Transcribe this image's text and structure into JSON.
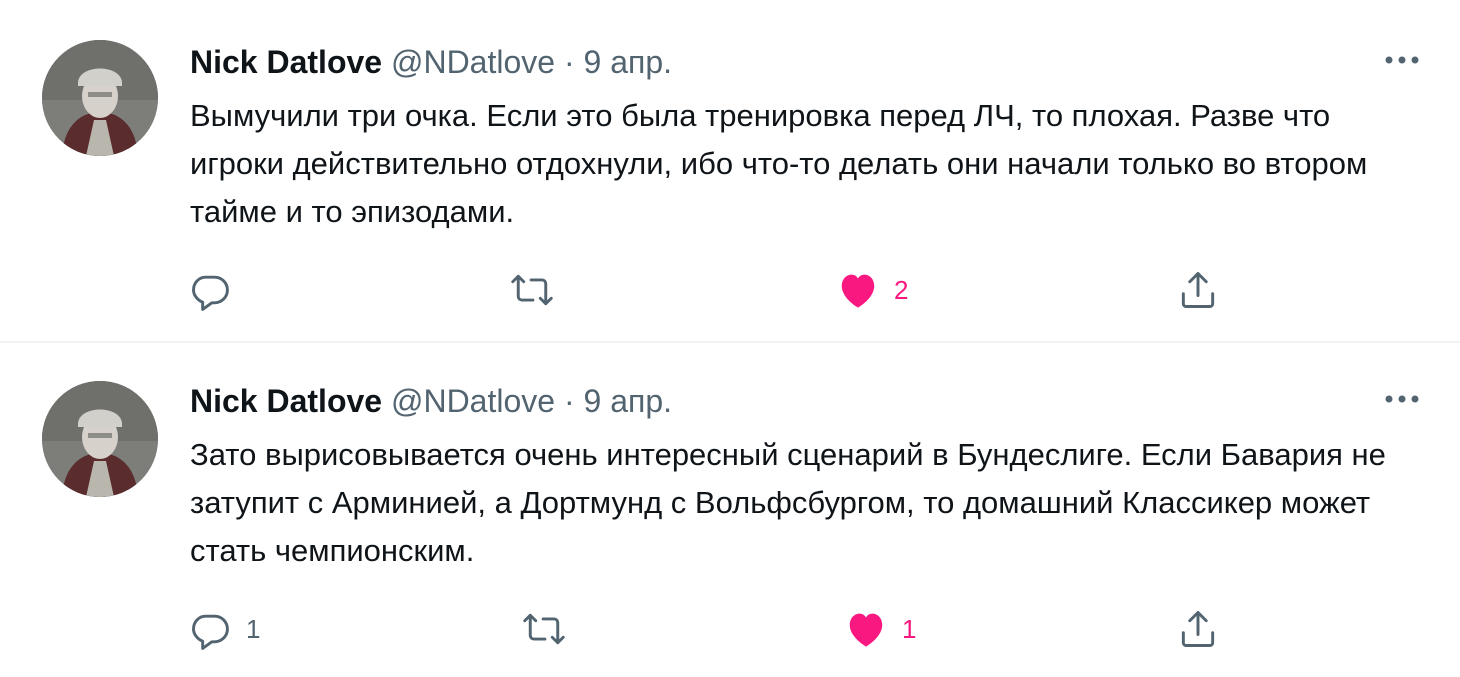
{
  "colors": {
    "text_primary": "#0f1419",
    "text_secondary": "#536471",
    "like_active": "#f91880",
    "divider": "#eff3f4"
  },
  "tweets": [
    {
      "author": {
        "name": "Nick Datlove",
        "handle": "@NDatlove"
      },
      "separator": "·",
      "date": "9 апр.",
      "text": "Вымучили три очка. Если это была тренировка перед ЛЧ, то плохая. Разве что игроки действительно отдохнули, ибо что-то делать они начали только во втором тайме и то эпизодами.",
      "reply_count": "",
      "retweet_count": "",
      "like_count": "2",
      "liked": true,
      "icons": {
        "reply": "reply-icon",
        "retweet": "retweet-icon",
        "like": "heart-icon",
        "share": "share-icon",
        "more": "more-icon"
      }
    },
    {
      "author": {
        "name": "Nick Datlove",
        "handle": "@NDatlove"
      },
      "separator": "·",
      "date": "9 апр.",
      "text": "Зато вырисовывается очень интересный сценарий в Бундеслиге. Если Бавария не затупит с Арминией, а Дортмунд с Вольфсбургом, то домашний Классикер может стать чемпионским.",
      "reply_count": "1",
      "retweet_count": "",
      "like_count": "1",
      "liked": true,
      "icons": {
        "reply": "reply-icon",
        "retweet": "retweet-icon",
        "like": "heart-icon",
        "share": "share-icon",
        "more": "more-icon"
      }
    }
  ]
}
